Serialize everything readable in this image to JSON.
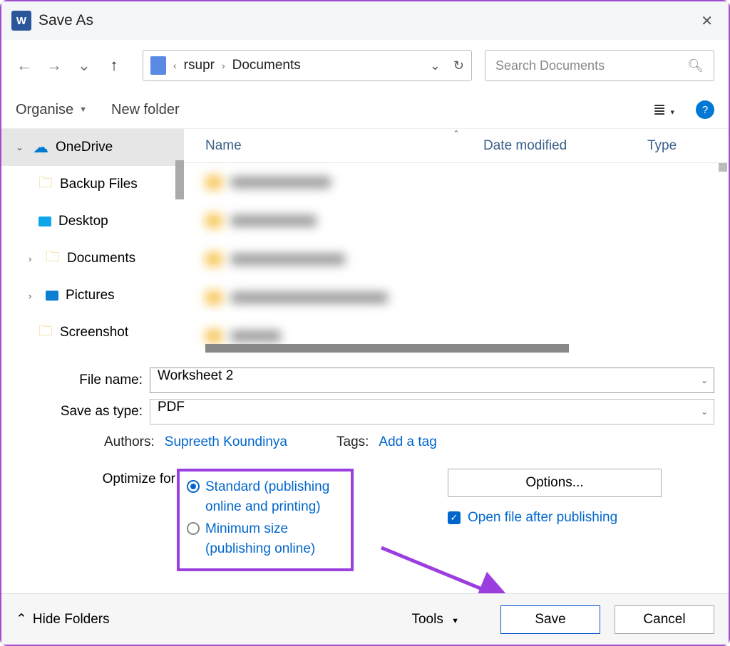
{
  "title": "Save As",
  "breadcrumb": {
    "parent": "rsupr",
    "current": "Documents"
  },
  "search": {
    "placeholder": "Search Documents"
  },
  "toolbar": {
    "organise": "Organise",
    "newfolder": "New folder"
  },
  "tree": {
    "root": "OneDrive",
    "items": [
      "Backup Files",
      "Desktop",
      "Documents",
      "Pictures",
      "Screenshot"
    ]
  },
  "columns": {
    "name": "Name",
    "date": "Date modified",
    "type": "Type"
  },
  "form": {
    "filename_label": "File name:",
    "filename_value": "Worksheet 2",
    "type_label": "Save as type:",
    "type_value": "PDF",
    "authors_label": "Authors:",
    "authors_value": "Supreeth Koundinya",
    "tags_label": "Tags:",
    "tags_value": "Add a tag",
    "optimize_label": "Optimize for",
    "radio1": "Standard (publishing online and printing)",
    "radio2": "Minimum size (publishing online)",
    "options_btn": "Options...",
    "open_after": "Open file after publishing"
  },
  "bottom": {
    "hide": "Hide Folders",
    "tools": "Tools",
    "save": "Save",
    "cancel": "Cancel"
  }
}
